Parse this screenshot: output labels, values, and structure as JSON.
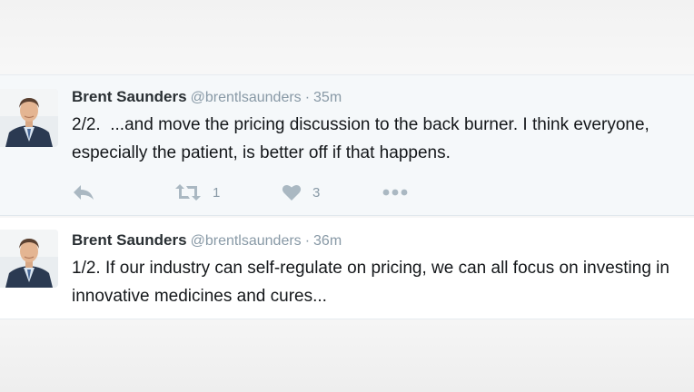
{
  "colors": {
    "name": "#292f33",
    "meta": "#8899a6",
    "text": "#14171a",
    "icon": "#aab8c2"
  },
  "tweets": [
    {
      "author_name": "Brent Saunders",
      "handle": "@brentlsaunders",
      "separator": "·",
      "time": "35m",
      "text": "2/2.  ...and move the pricing discussion to the back burner. I think everyone, especially the patient, is better off if that happens.",
      "actions": {
        "reply_icon": "reply-icon",
        "retweet_icon": "retweet-icon",
        "retweet_count": "1",
        "like_icon": "heart-icon",
        "like_count": "3",
        "more_icon": "more-dots-icon"
      }
    },
    {
      "author_name": "Brent Saunders",
      "handle": "@brentlsaunders",
      "separator": "·",
      "time": "36m",
      "text": "1/2. If our industry can self-regulate on pricing, we can all focus on investing in innovative medicines and cures..."
    }
  ]
}
